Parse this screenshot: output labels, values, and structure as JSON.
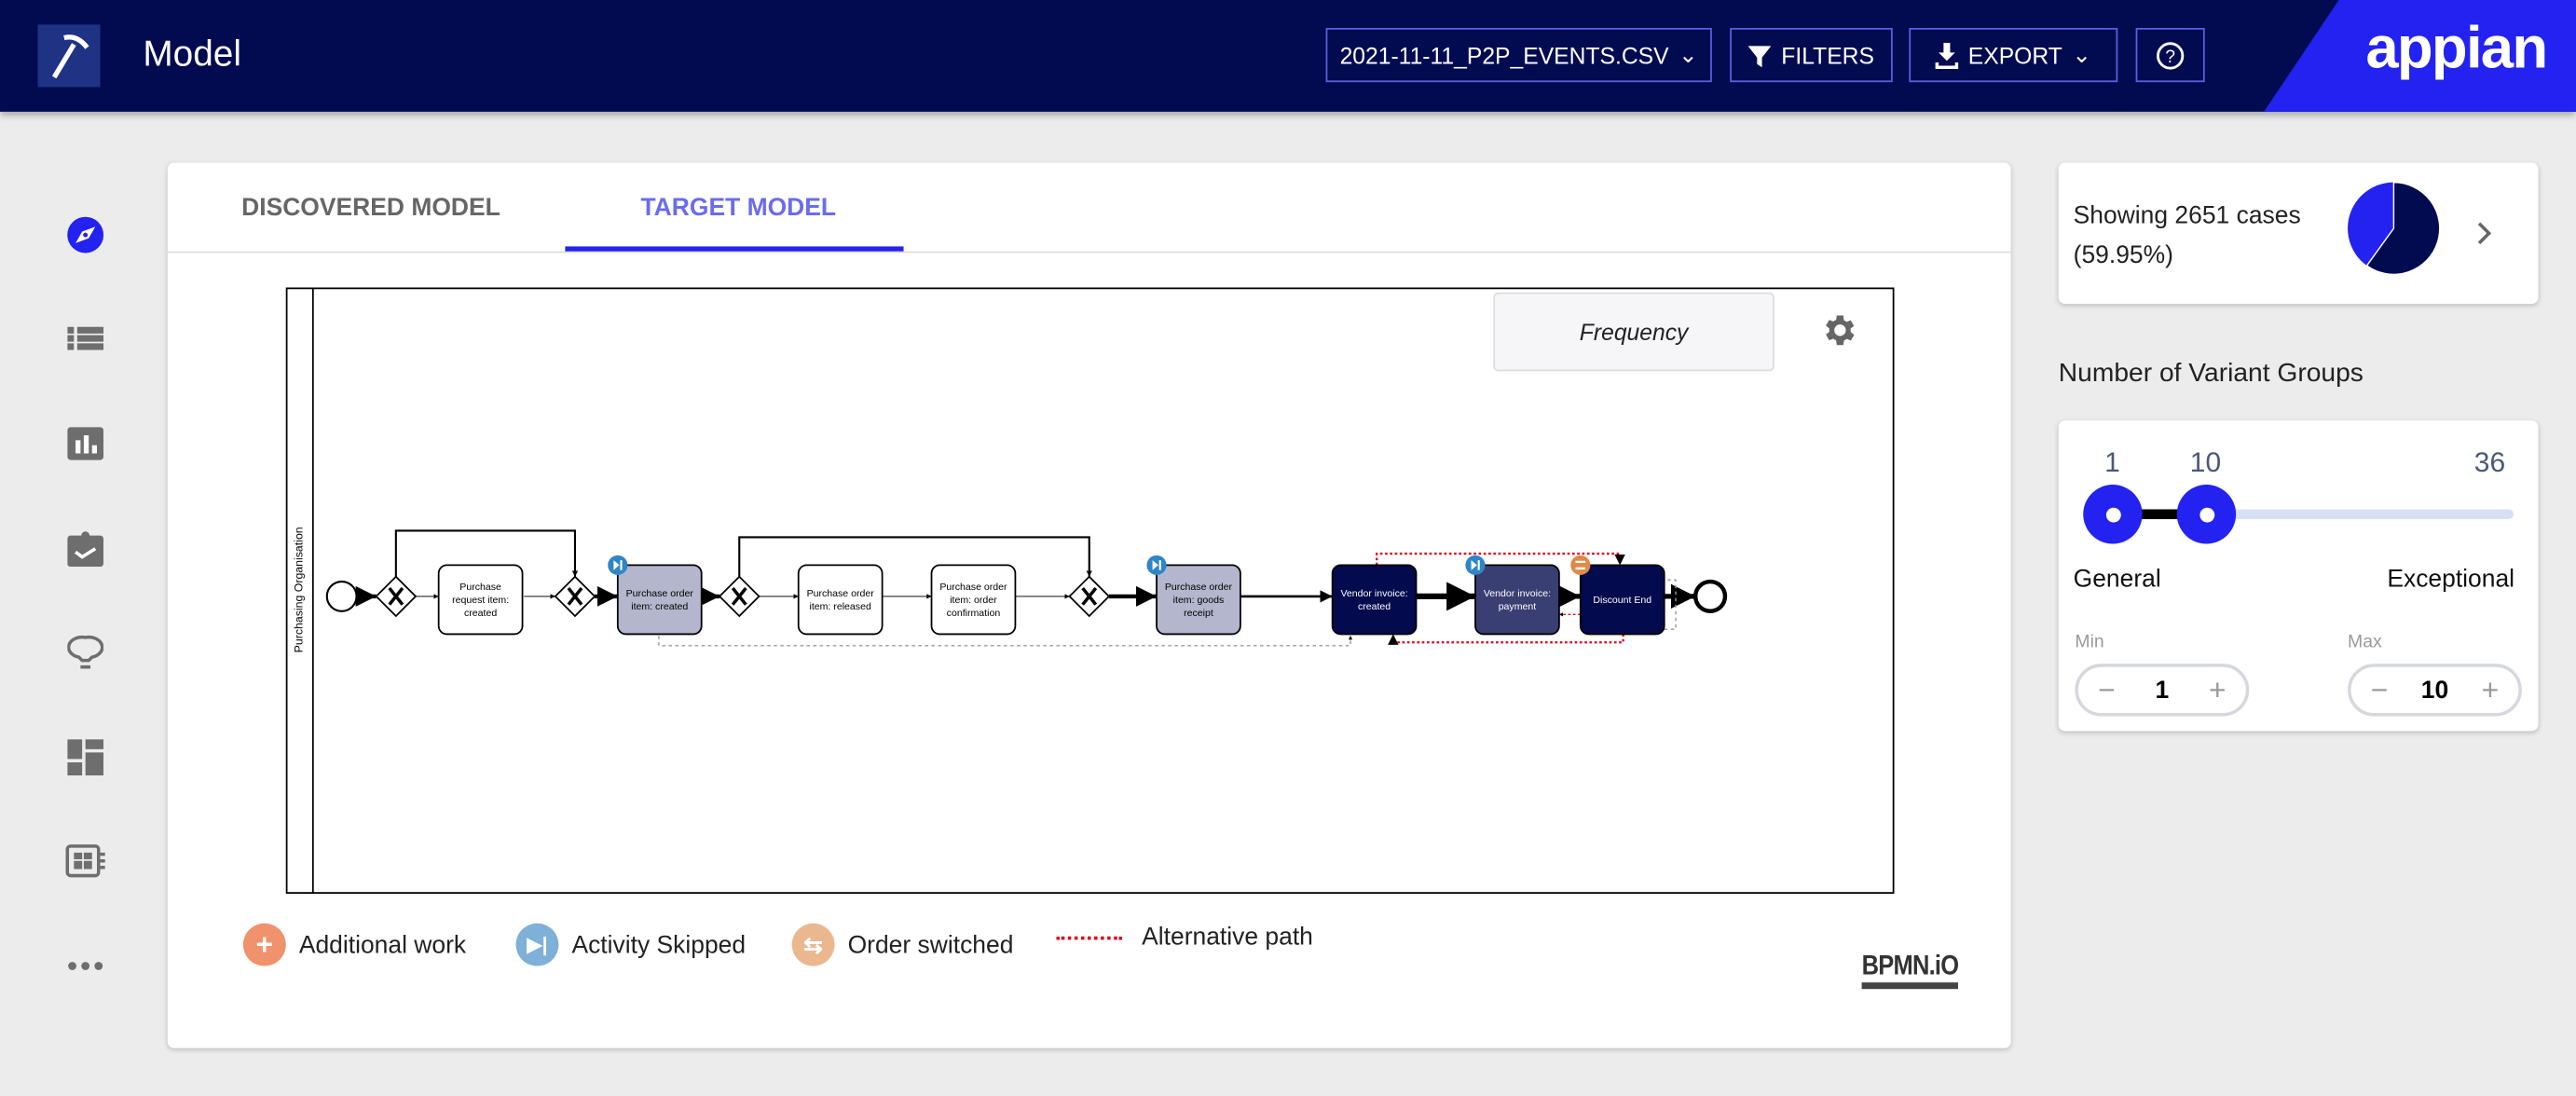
{
  "header": {
    "title": "Model",
    "file_select": "2021-11-11_P2P_EVENTS.CSV",
    "filters": "FILTERS",
    "export": "EXPORT",
    "help_icon": "help-circle-icon",
    "brand": "appian",
    "colors": {
      "header": "#020b50",
      "accent": "#2322f0"
    }
  },
  "sidebar": {
    "items": [
      {
        "icon": "compass-icon",
        "active": true
      },
      {
        "icon": "list-icon"
      },
      {
        "icon": "bar-chart-icon"
      },
      {
        "icon": "clipboard-check-icon"
      },
      {
        "icon": "lightbulb-icon"
      },
      {
        "icon": "dashboard-icon"
      },
      {
        "icon": "report-icon"
      },
      {
        "icon": "more-icon"
      }
    ]
  },
  "tabs": [
    {
      "label": "DISCOVERED MODEL",
      "active": false
    },
    {
      "label": "TARGET MODEL",
      "active": true
    }
  ],
  "diagram": {
    "lane": "Purchasing Organisation",
    "overlay_mode": "Frequency",
    "tasks": [
      {
        "label": "Purchase request item: created",
        "style": "white"
      },
      {
        "label": "Purchase order item: created",
        "style": "skipped"
      },
      {
        "label": "Purchase order item: released",
        "style": "white"
      },
      {
        "label": "Purchase order item: order confirmation",
        "style": "white"
      },
      {
        "label": "Purchase order item: goods receipt",
        "style": "skipped"
      },
      {
        "label": "Vendor invoice: created",
        "style": "dark"
      },
      {
        "label": "Vendor invoice: payment",
        "style": "mid"
      },
      {
        "label": "Discount End",
        "style": "dark"
      }
    ],
    "watermark": "BPMN.iO"
  },
  "legend": [
    {
      "label": "Additional work",
      "color": "#f0926b",
      "icon": "plus-icon"
    },
    {
      "label": "Activity Skipped",
      "color": "#7eb0d8",
      "icon": "skip-icon"
    },
    {
      "label": "Order switched",
      "color": "#eab78f",
      "icon": "swap-icon"
    },
    {
      "label": "Alternative path",
      "color": "#e0001b",
      "icon": "dotted-line-icon"
    }
  ],
  "cases": {
    "text": "Showing 2651 cases",
    "percent_text": "(59.95%)",
    "fraction": 0.5995
  },
  "variants": {
    "title": "Number of Variant Groups",
    "min_label_val": "1",
    "max_label_val": "10",
    "range_max": "36",
    "left_label": "General",
    "right_label": "Exceptional",
    "min_caption": "Min",
    "max_caption": "Max",
    "min": "1",
    "max": "10"
  }
}
